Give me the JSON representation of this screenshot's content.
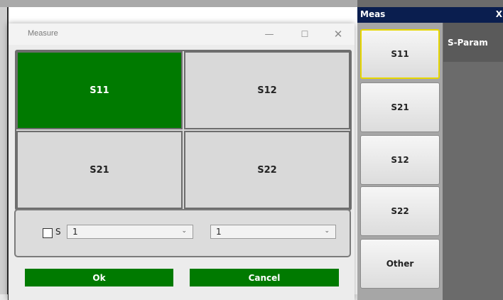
{
  "dialog": {
    "title": "Measure",
    "window_controls": {
      "minimize": "—",
      "maximize": "☐",
      "close": "✕"
    },
    "grid": [
      {
        "label": "S11",
        "selected": true
      },
      {
        "label": "S12",
        "selected": false
      },
      {
        "label": "S21",
        "selected": false
      },
      {
        "label": "S22",
        "selected": false
      }
    ],
    "options": {
      "checkbox_label": "S",
      "checkbox_checked": false,
      "select_1_value": "1",
      "select_2_value": "1",
      "chevron": "⌄"
    },
    "ok_label": "Ok",
    "cancel_label": "Cancel"
  },
  "side_panel": {
    "title": "Meas",
    "close": "X",
    "softkeys": [
      "S11",
      "S21",
      "S12",
      "S22",
      "Other"
    ],
    "active_softkey": "S11",
    "tab_label": "S-Param"
  },
  "colors": {
    "selected_green": "#007a00",
    "panel_header": "#0a1e4f",
    "active_border": "#e6d600"
  },
  "icons": [
    "minimize-icon",
    "maximize-icon",
    "close-icon",
    "chevron-down-icon",
    "checkbox-icon"
  ]
}
